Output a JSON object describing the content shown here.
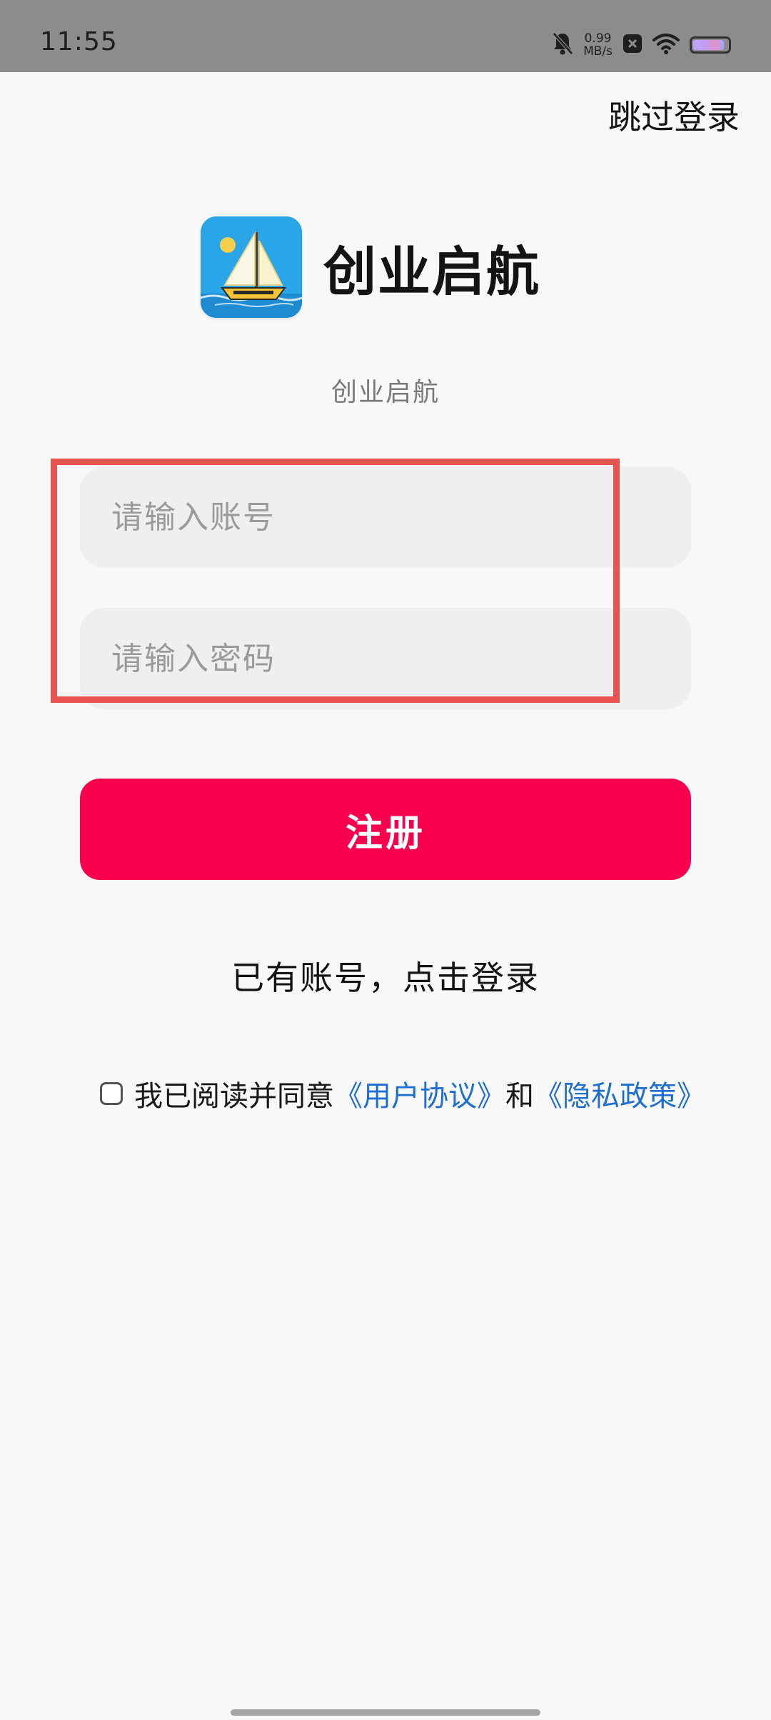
{
  "status_bar": {
    "time": "11:55",
    "net_speed_value": "0.99",
    "net_speed_unit": "MB/s",
    "battery_level": 0.9,
    "icons": [
      "bell-muted-icon",
      "close-box-icon",
      "wifi-icon",
      "battery-icon"
    ]
  },
  "header": {
    "skip_label": "跳过登录"
  },
  "brand": {
    "app_name": "创业启航",
    "subtitle": "创业启航",
    "icon": "sailboat-app-icon"
  },
  "form": {
    "account_placeholder": "请输入账号",
    "password_placeholder": "请输入密码",
    "account_value": "",
    "password_value": ""
  },
  "actions": {
    "register_label": "注册",
    "login_link_label": "已有账号，点击登录"
  },
  "agreement": {
    "checked": false,
    "text_prefix": "我已阅读并同意",
    "user_agreement": "《用户协议》",
    "conjunction": "和",
    "privacy_policy": "《隐私政策》"
  },
  "colors": {
    "accent": "#f9004f",
    "link": "#1e6fd0",
    "highlight": "#e8534f",
    "status_bar": "#8c8c8e"
  }
}
